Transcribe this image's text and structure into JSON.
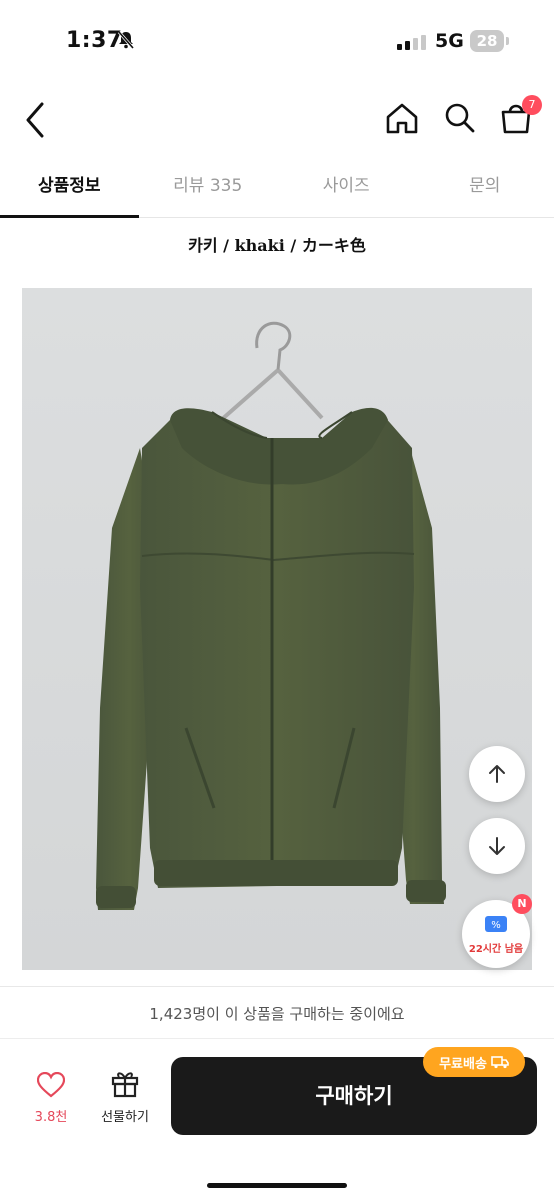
{
  "status_bar": {
    "time": "1:37",
    "network": "5G",
    "battery": "28"
  },
  "nav": {
    "back_icon": "chevron-left-icon",
    "icons": [
      "home-icon",
      "search-icon",
      "shopping-bag-icon"
    ],
    "cart_count": "7"
  },
  "tabs": [
    {
      "label": "상품정보",
      "active": true
    },
    {
      "label": "리뷰 335",
      "active": false
    },
    {
      "label": "사이즈",
      "active": false
    },
    {
      "label": "문의",
      "active": false
    }
  ],
  "content": {
    "color_caption": "카키 / khaki / カーキ色"
  },
  "floating": {
    "scroll_up_icon": "arrow-up-icon",
    "scroll_down_icon": "arrow-down-icon",
    "coupon_badge": "N",
    "coupon_text": "22시간 남음"
  },
  "bottom": {
    "buyers_text": "1,423명이 이 상품을 구매하는 중이에요",
    "like_count": "3.8천",
    "gift_label": "선물하기",
    "buy_label": "구매하기",
    "shipping_badge": "무료배송"
  },
  "colors": {
    "accent_red": "#ff4d5e",
    "shipping_orange": "#ffa51f",
    "jacket_khaki": "#4e5a3f"
  }
}
